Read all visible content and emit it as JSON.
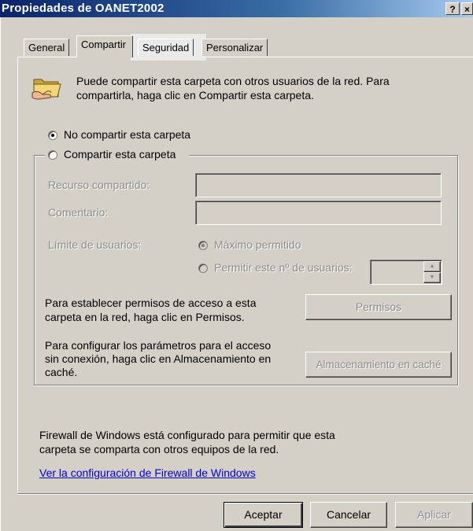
{
  "window": {
    "title": "Propiedades de OANET2002",
    "help_btn": "?",
    "close_btn": "×"
  },
  "tabs": [
    "General",
    "Compartir",
    "Seguridad",
    "Personalizar"
  ],
  "info": {
    "icon": "folder-share-icon",
    "line1": "Puede compartir esta carpeta con otros usuarios de la red. Para",
    "line2": "compartirla, haga clic en Compartir esta carpeta."
  },
  "sharing": {
    "no_share": "No compartir esta carpeta",
    "share": "Compartir esta carpeta",
    "selected": "no_share"
  },
  "fields": {
    "share_name_label": "Recurso compartido:",
    "share_name_value": "",
    "comment_label": "Comentario:",
    "comment_value": "",
    "user_limit_label": "Límite de usuarios:",
    "max_allowed": "Máximo permitido",
    "allow_n_users": "Permitir este nº de usuarios:",
    "user_count_value": ""
  },
  "permissions": {
    "line1": "Para establecer permisos de acceso a esta",
    "line2": "carpeta en la red, haga clic en Permisos.",
    "button": "Permisos"
  },
  "caching": {
    "line1": "Para configurar los parámetros para el acceso",
    "line2": "sin conexión, haga clic en Almacenamiento en",
    "line3": "caché.",
    "button": "Almacenamiento en caché"
  },
  "firewall": {
    "line1": "Firewall de Windows está configurado para permitir que esta",
    "line2": "carpeta se comparta con otros equipos de la red.",
    "link": "Ver la configuración de Firewall de Windows"
  },
  "buttons": {
    "ok": "Aceptar",
    "cancel": "Cancelar",
    "apply": "Aplicar"
  },
  "colors": {
    "titlebar": "#0a246a",
    "face": "#d4d0c8",
    "link": "#0000cc",
    "disabled_text": "#8c8c8c"
  }
}
